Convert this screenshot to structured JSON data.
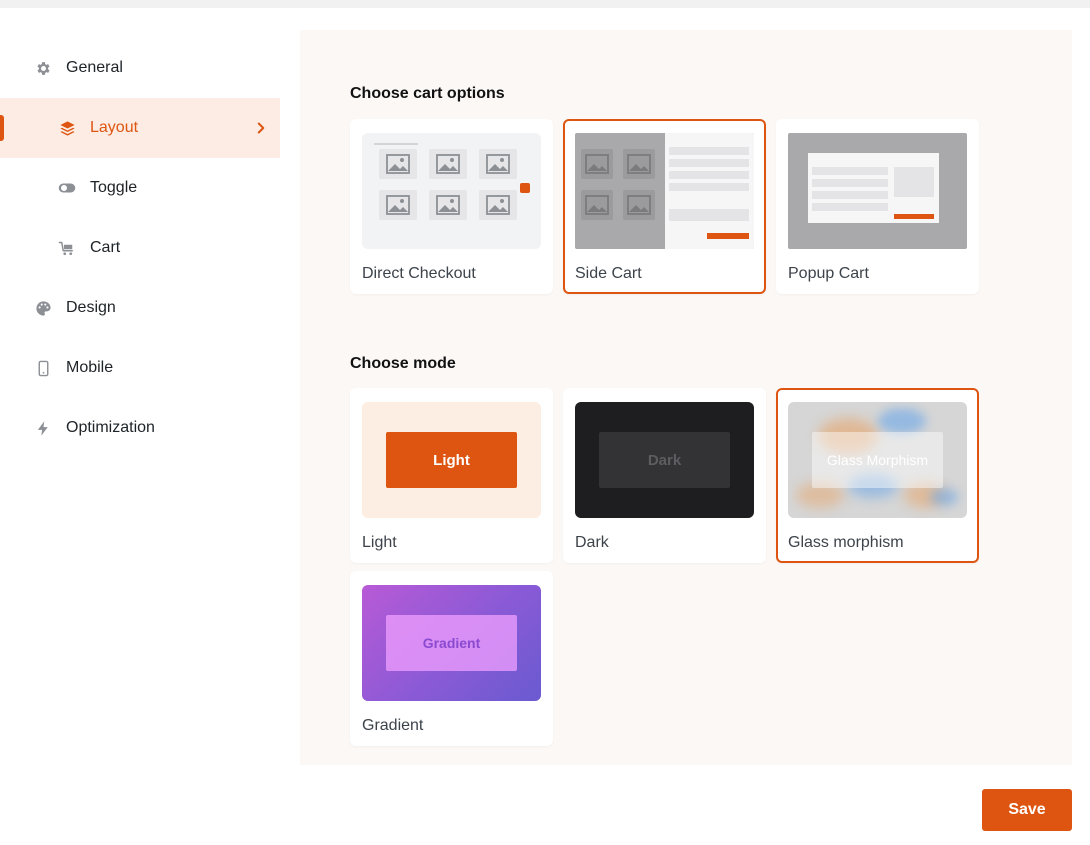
{
  "sidebar": {
    "items": [
      {
        "label": "General",
        "icon": "gear-icon"
      },
      {
        "label": "Layout",
        "icon": "layers-icon",
        "active": true
      },
      {
        "label": "Toggle",
        "icon": "toggle-icon"
      },
      {
        "label": "Cart",
        "icon": "cart-icon"
      },
      {
        "label": "Design",
        "icon": "palette-icon"
      },
      {
        "label": "Mobile",
        "icon": "mobile-icon"
      },
      {
        "label": "Optimization",
        "icon": "bolt-icon"
      }
    ]
  },
  "cart_options": {
    "title": "Choose cart options",
    "options": [
      {
        "label": "Direct Checkout",
        "selected": false
      },
      {
        "label": "Side Cart",
        "selected": true
      },
      {
        "label": "Popup Cart",
        "selected": false
      }
    ]
  },
  "mode": {
    "title": "Choose mode",
    "options": [
      {
        "label": "Light",
        "preview_text": "Light",
        "selected": false
      },
      {
        "label": "Dark",
        "preview_text": "Dark",
        "selected": false
      },
      {
        "label": "Glass morphism",
        "preview_text": "Glass Morphism",
        "selected": true
      },
      {
        "label": "Gradient",
        "preview_text": "Gradient",
        "selected": false
      }
    ]
  },
  "actions": {
    "save_label": "Save"
  },
  "colors": {
    "accent": "#dd5511",
    "active_bg": "#fdece3",
    "panel_bg": "#fcf8f6"
  }
}
